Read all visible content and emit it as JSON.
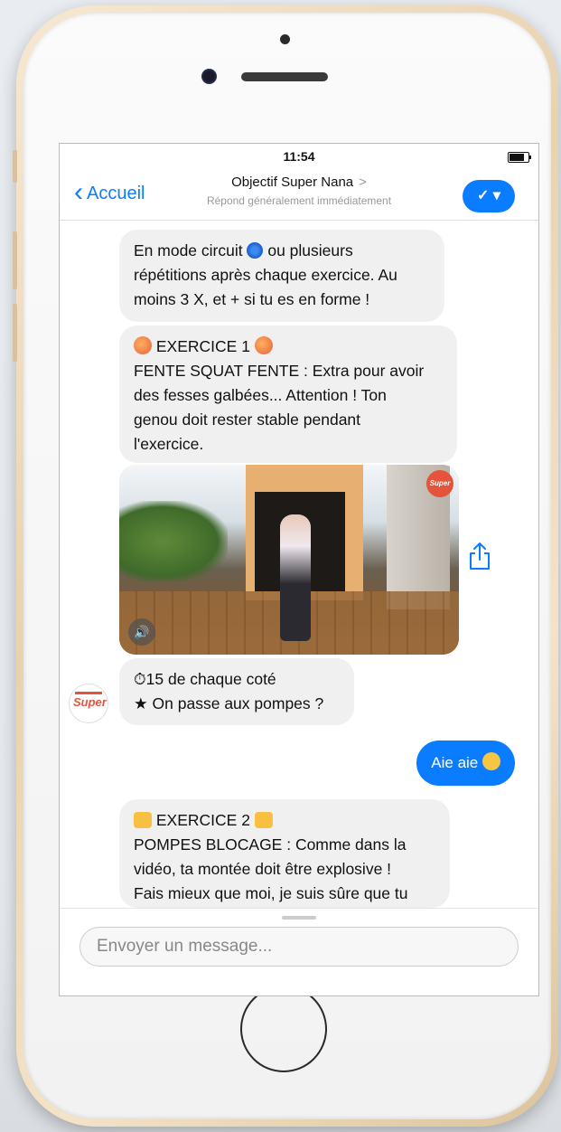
{
  "status_bar": {
    "time": "11:54"
  },
  "nav": {
    "back_label": "Accueil",
    "title": "Objectif Super Nana",
    "title_arrow": ">",
    "subtitle": "Répond généralement immédiatement",
    "action_icon": "check-dropdown-icon"
  },
  "messages": [
    {
      "from": "bot",
      "lines": [
        "En mode circuit",
        "ou plusieurs",
        "répétitions après chaque exercice. Au",
        "moins 3 X, et + si tu es en forme !"
      ]
    },
    {
      "from": "bot",
      "lines": [
        "EXERCICE 1",
        "FENTE SQUAT FENTE : Extra pour avoir",
        "des fesses galbées... Attention ! Ton",
        "genou doit rester stable pendant",
        "l'exercice."
      ]
    },
    {
      "from": "bot",
      "type": "video",
      "logo_text": "Super"
    },
    {
      "from": "bot",
      "lines": [
        "15 de chaque coté",
        "★ On passe aux pompes ?"
      ]
    },
    {
      "from": "user",
      "text": "Aie aie"
    },
    {
      "from": "bot",
      "lines": [
        "EXERCICE 2",
        "POMPES BLOCAGE : Comme dans la",
        "vidéo, ta montée doit être explosive !",
        "Fais mieux que moi, je suis sûre que tu"
      ]
    }
  ],
  "avatar": {
    "logo_text": "Super"
  },
  "composer": {
    "placeholder": "Envoyer un message..."
  },
  "colors": {
    "accent": "#0a7cff",
    "bubble": "#f0f0f0",
    "brand": "#e5533b"
  }
}
